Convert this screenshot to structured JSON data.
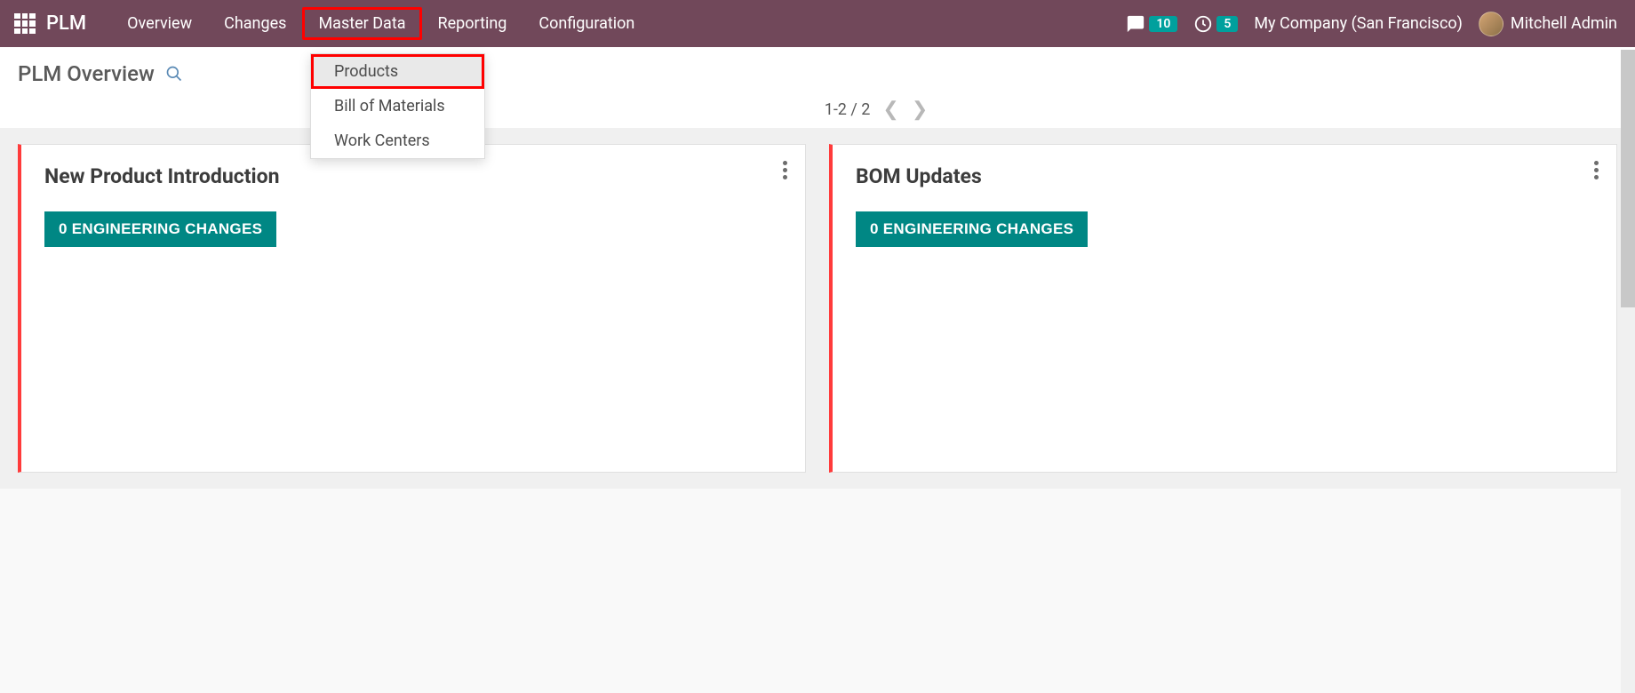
{
  "header": {
    "brand": "PLM",
    "nav": [
      {
        "label": "Overview"
      },
      {
        "label": "Changes"
      },
      {
        "label": "Master Data"
      },
      {
        "label": "Reporting"
      },
      {
        "label": "Configuration"
      }
    ],
    "chat_count": "10",
    "clock_count": "5",
    "company": "My Company (San Francisco)",
    "username": "Mitchell Admin"
  },
  "dropdown": {
    "items": [
      {
        "label": "Products"
      },
      {
        "label": "Bill of Materials"
      },
      {
        "label": "Work Centers"
      }
    ]
  },
  "page": {
    "title": "PLM Overview",
    "pager": "1-2 / 2"
  },
  "cards": [
    {
      "title": "New Product Introduction",
      "button": "0 ENGINEERING CHANGES"
    },
    {
      "title": "BOM Updates",
      "button": "0 ENGINEERING CHANGES"
    }
  ]
}
